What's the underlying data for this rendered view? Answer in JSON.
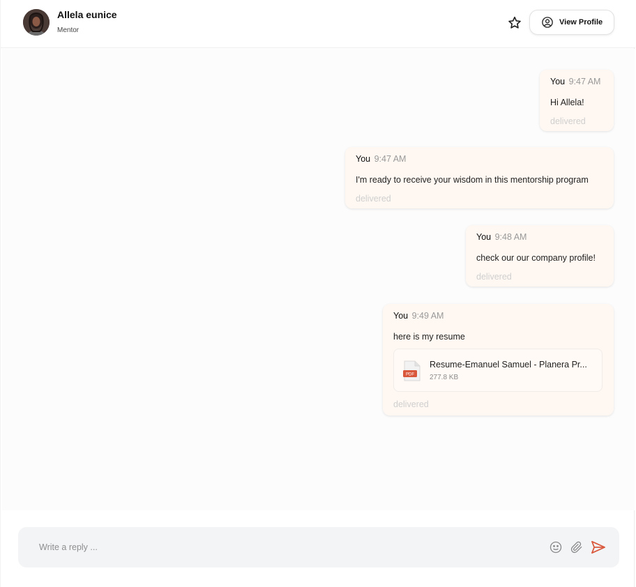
{
  "header": {
    "name": "Allela eunice",
    "role": "Mentor",
    "view_profile_label": "View Profile"
  },
  "messages": [
    {
      "sender": "You",
      "time": "9:47 AM",
      "text": "Hi Allela!",
      "status": "delivered"
    },
    {
      "sender": "You",
      "time": "9:47 AM",
      "text": "I'm ready to receive your wisdom in this mentorship program",
      "status": "delivered"
    },
    {
      "sender": "You",
      "time": "9:48 AM",
      "text": "check our our company profile!",
      "status": "delivered"
    },
    {
      "sender": "You",
      "time": "9:49 AM",
      "text": "here is my resume",
      "status": "delivered",
      "attachment": {
        "name": "Resume-Emanuel Samuel - Planera Pr...",
        "size": "277.8 KB",
        "type_label": "PDF"
      }
    }
  ],
  "composer": {
    "placeholder": "Write a reply ..."
  },
  "colors": {
    "accent": "#d9573b",
    "bubble_bg": "#fff8f2",
    "status": "#cfcfcf"
  }
}
